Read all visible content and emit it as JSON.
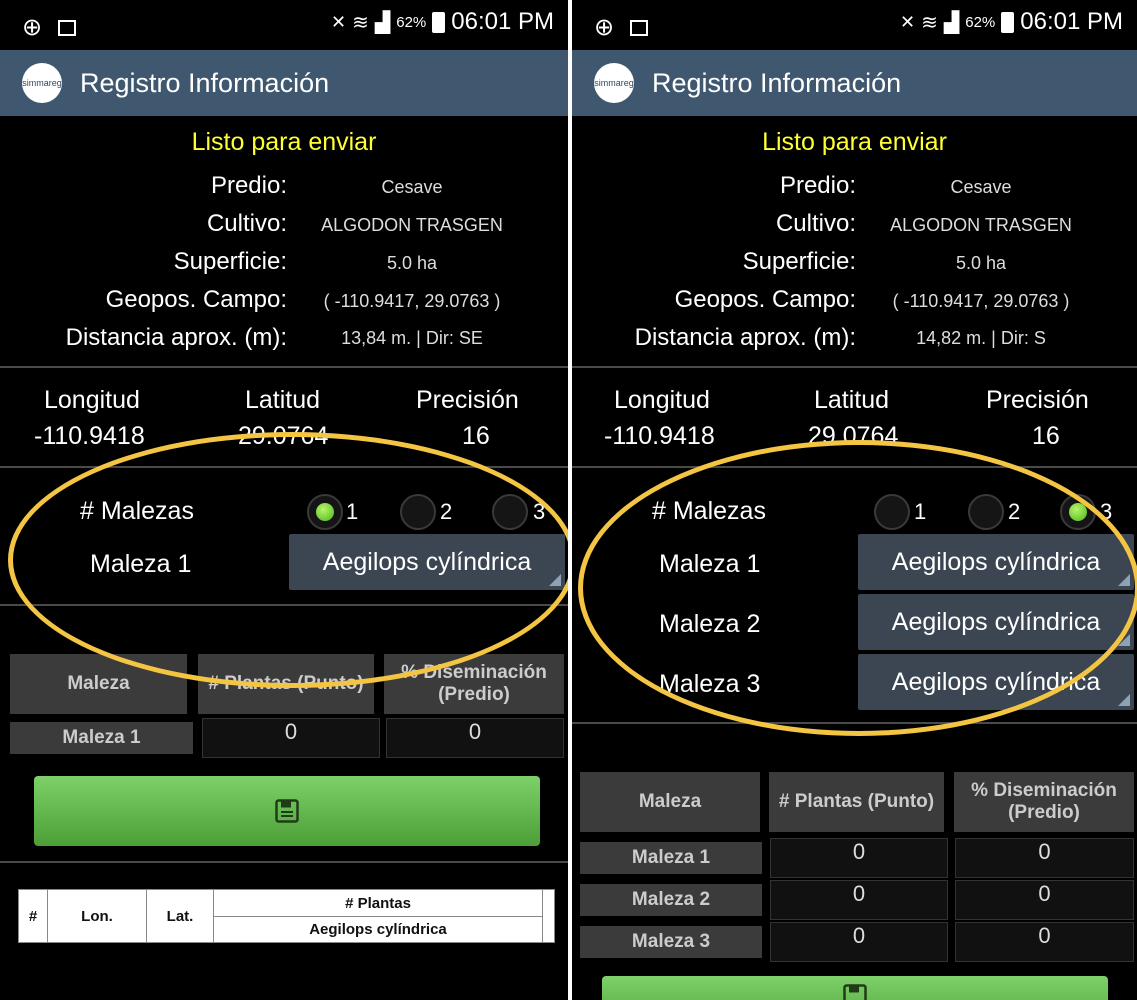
{
  "left": {
    "status": {
      "battery_pct": "62%",
      "time": "06:01 PM"
    },
    "app_title": "Registro Información",
    "logo_text": "simmareg",
    "ready_text": "Listo para enviar",
    "info": {
      "predio_label": "Predio:",
      "predio": "Cesave",
      "cultivo_label": "Cultivo:",
      "cultivo": "ALGODON TRASGEN",
      "superficie_label": "Superficie:",
      "superficie": "5.0 ha",
      "geopos_label": "Geopos. Campo:",
      "geopos": "( -110.9417, 29.0763 )",
      "distancia_label": "Distancia aprox. (m):",
      "distancia": "13,84 m. | Dir: SE"
    },
    "gps": {
      "lon_label": "Longitud",
      "lat_label": "Latitud",
      "prec_label": "Precisión",
      "lon": "-110.9418",
      "lat": "29.0764",
      "prec": "16"
    },
    "malezas_label": "# Malezas",
    "radios": [
      "1",
      "2",
      "3"
    ],
    "selected_count": "1",
    "malezas": [
      {
        "label": "Maleza 1",
        "value": "Aegilops cylíndrica"
      }
    ],
    "table": {
      "col1": "Maleza",
      "col2": "# Plantas (Punto)",
      "col3": "% Diseminación (Predio)",
      "rows": [
        {
          "name": "Maleza 1",
          "plantas": "0",
          "disem": "0"
        }
      ]
    },
    "bottom_table": {
      "h_num": "#",
      "h_lon": "Lon.",
      "h_lat": "Lat.",
      "h_plantas": "# Plantas",
      "h_species": "Aegilops cylíndrica"
    }
  },
  "right": {
    "status": {
      "battery_pct": "62%",
      "time": "06:01 PM"
    },
    "app_title": "Registro Información",
    "logo_text": "simmareg",
    "ready_text": "Listo para enviar",
    "info": {
      "predio_label": "Predio:",
      "predio": "Cesave",
      "cultivo_label": "Cultivo:",
      "cultivo": "ALGODON TRASGEN",
      "superficie_label": "Superficie:",
      "superficie": "5.0 ha",
      "geopos_label": "Geopos. Campo:",
      "geopos": "( -110.9417, 29.0763 )",
      "distancia_label": "Distancia aprox. (m):",
      "distancia": "14,82 m. | Dir: S"
    },
    "gps": {
      "lon_label": "Longitud",
      "lat_label": "Latitud",
      "prec_label": "Precisión",
      "lon": "-110.9418",
      "lat": "29.0764",
      "prec": "16"
    },
    "malezas_label": "# Malezas",
    "radios": [
      "1",
      "2",
      "3"
    ],
    "selected_count": "3",
    "malezas": [
      {
        "label": "Maleza 1",
        "value": "Aegilops cylíndrica"
      },
      {
        "label": "Maleza 2",
        "value": "Aegilops cylíndrica"
      },
      {
        "label": "Maleza 3",
        "value": "Aegilops cylíndrica"
      }
    ],
    "table": {
      "col1": "Maleza",
      "col2": "# Plantas (Punto)",
      "col3": "% Diseminación (Predio)",
      "rows": [
        {
          "name": "Maleza 1",
          "plantas": "0",
          "disem": "0"
        },
        {
          "name": "Maleza 2",
          "plantas": "0",
          "disem": "0"
        },
        {
          "name": "Maleza 3",
          "plantas": "0",
          "disem": "0"
        }
      ]
    }
  },
  "annotation_color": "#f4c542"
}
